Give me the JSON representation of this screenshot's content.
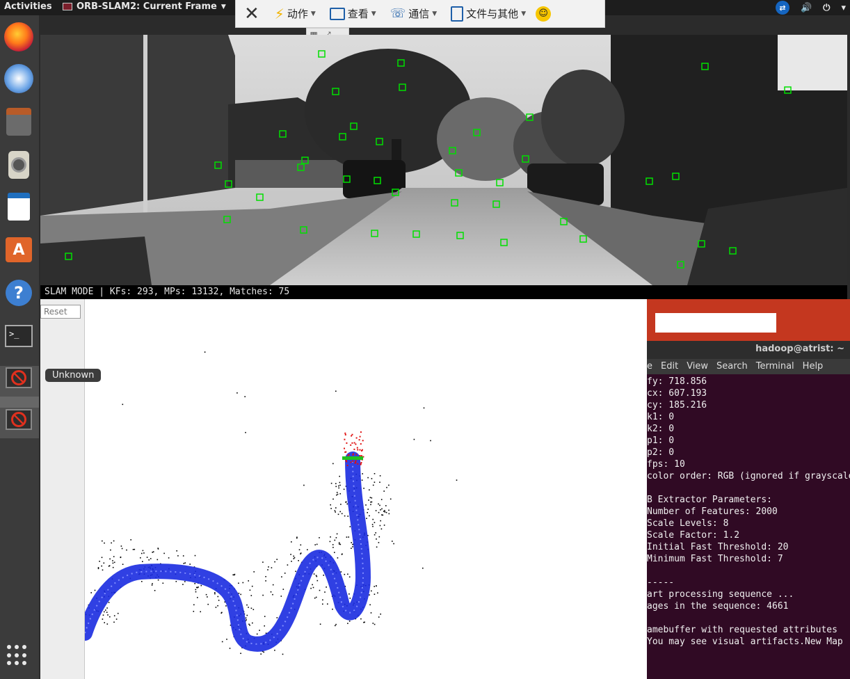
{
  "topbar": {
    "activities": "Activities",
    "app_title": "ORB-SLAM2: Current Frame",
    "tray_icons": [
      "teamviewer-icon",
      "volume-icon",
      "power-icon",
      "chevron-down-icon"
    ]
  },
  "remote_toolbar": {
    "items": [
      {
        "label": "动作",
        "icon": "bolt-icon"
      },
      {
        "label": "查看",
        "icon": "monitor-icon"
      },
      {
        "label": "通信",
        "icon": "phone-icon"
      },
      {
        "label": "文件与其他",
        "icon": "file-icon"
      }
    ],
    "smile": "☺"
  },
  "dock": {
    "items": [
      "firefox-icon",
      "thunderbird-icon",
      "files-icon",
      "rhythmbox-icon",
      "libreoffice-writer-icon",
      "ubuntu-software-icon",
      "help-icon",
      "terminal-icon",
      "unknown-app-icon",
      "unknown-app-icon"
    ],
    "tooltip": "Unknown",
    "terminal_prompt": ">_"
  },
  "frame": {
    "status": "SLAM MODE |  KFs: 293, MPs: 13132, Matches: 75",
    "feature_color": "#00e000"
  },
  "map_viewer": {
    "reset_label": "Reset"
  },
  "terminal": {
    "title": "hadoop@atrist: ~",
    "menu": [
      "e",
      "Edit",
      "View",
      "Search",
      "Terminal",
      "Help"
    ],
    "lines": [
      "fy: 718.856",
      "cx: 607.193",
      "cy: 185.216",
      "k1: 0",
      "k2: 0",
      "p1: 0",
      "p2: 0",
      "fps: 10",
      "color order: RGB (ignored if grayscale)",
      "",
      "B Extractor Parameters:",
      "Number of Features: 2000",
      "Scale Levels: 8",
      "Scale Factor: 1.2",
      "Initial Fast Threshold: 20",
      "Minimum Fast Threshold: 7",
      "",
      "-----",
      "art processing sequence ...",
      "ages in the sequence: 4661",
      "",
      "amebuffer with requested attributes",
      "You may see visual artifacts.New Map"
    ]
  },
  "colors": {
    "trajectory": "#1a2be0",
    "map_points": "#000000",
    "local_points": "#e01010",
    "current_cam": "#20c020",
    "terminal_bg": "#300a24",
    "accent_orange": "#c4371f"
  }
}
